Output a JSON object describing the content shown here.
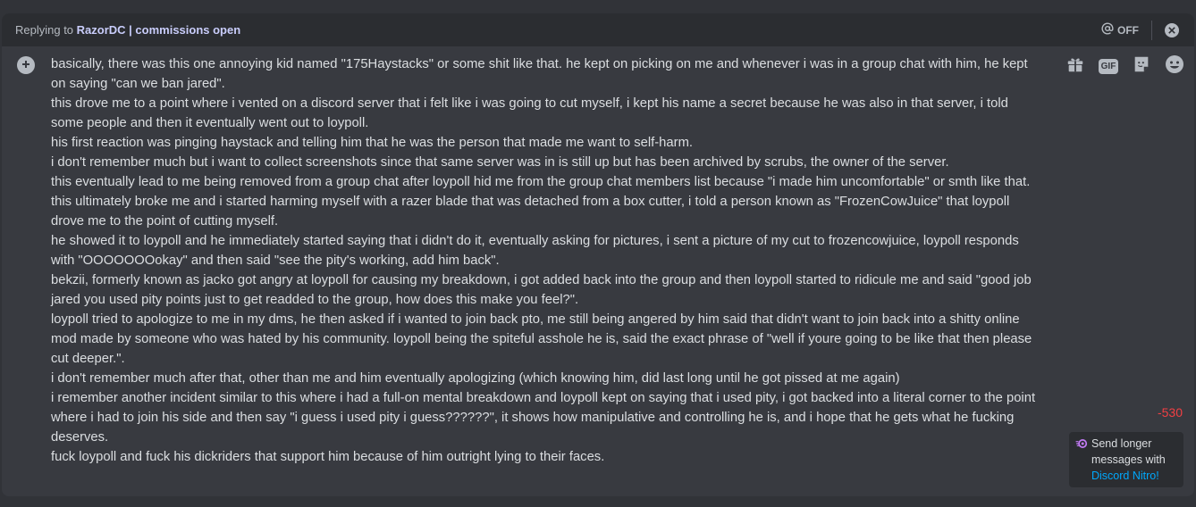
{
  "reply": {
    "prefix": "Replying to ",
    "username": "RazorDC | commissions open",
    "mention_toggle": "OFF"
  },
  "message": {
    "text": "basically, there was this one annoying kid named \"175Haystacks\" or some shit like that. he kept on picking on me and whenever i was in a group chat with him, he kept on saying \"can we ban jared\".\nthis drove me to a point where i vented on a discord server that i felt like i was going to cut myself, i kept his name a secret because he was also in that server, i told some people and then it eventually went out to loypoll.\nhis first reaction was pinging haystack and telling him that he was the person that made me want to self-harm.\ni don't remember much but i want to collect screenshots since that same server was in is still up but has been archived by scrubs, the owner of the server.\nthis eventually lead to me being removed from a group chat after loypoll hid me from the group chat members list because \"i made him uncomfortable\" or smth like that.\nthis ultimately broke me and i started harming myself with a razer blade that was detached from a box cutter, i told a person known as \"FrozenCowJuice\" that loypoll drove me to the point of cutting myself.\nhe showed it to loypoll and he immediately started saying that i didn't do it, eventually asking for pictures, i sent a picture of my cut to frozencowjuice, loypoll responds with \"OOOOOOOokay\" and then said \"see the pity's working, add him back\".\nbekzii, formerly known as jacko got angry at loypoll for causing my breakdown, i got added back into the group and then loypoll started to ridicule me and said \"good job jared you used pity points just to get readded to the group, how does this make you feel?\".\nloypoll tried to apologize to me in my dms, he then asked if i wanted to join back pto, me still being angered by him said that didn't want to join back into a shitty online mod made by someone who was hated by his community. loypoll being the spiteful asshole he is, said the exact phrase of \"well if youre going to be like that then please cut deeper.\".\ni don't remember much after that, other than me and him eventually apologizing (which knowing him, did last long until he got pissed at me again)\ni remember another incident similar to this where i had a full-on mental breakdown and loypoll kept on saying that i used pity, i got backed into a literal corner to the point where i had to join his side and then say \"i guess i used pity i guess??????\", it shows how manipulative and controlling he is, and i hope that he gets what he fucking deserves.\nfuck loypoll and fuck his dickriders that support him because of him outright lying to their faces."
  },
  "tools": [
    {
      "name": "gift-icon"
    },
    {
      "name": "gif-icon",
      "label": "GIF"
    },
    {
      "name": "sticker-icon"
    },
    {
      "name": "emoji-icon"
    }
  ],
  "char_counter": "-530",
  "nitro_promo": {
    "text": "Send longer messages with ",
    "link": "Discord Nitro!"
  },
  "colors": {
    "background": "#313338",
    "composer": "#383a40",
    "reply_bar": "#2b2d31",
    "text": "#dbdee1",
    "muted": "#b5bac1",
    "danger": "#f23f43",
    "link": "#00a8fc",
    "nitro": "#c27bf5"
  }
}
